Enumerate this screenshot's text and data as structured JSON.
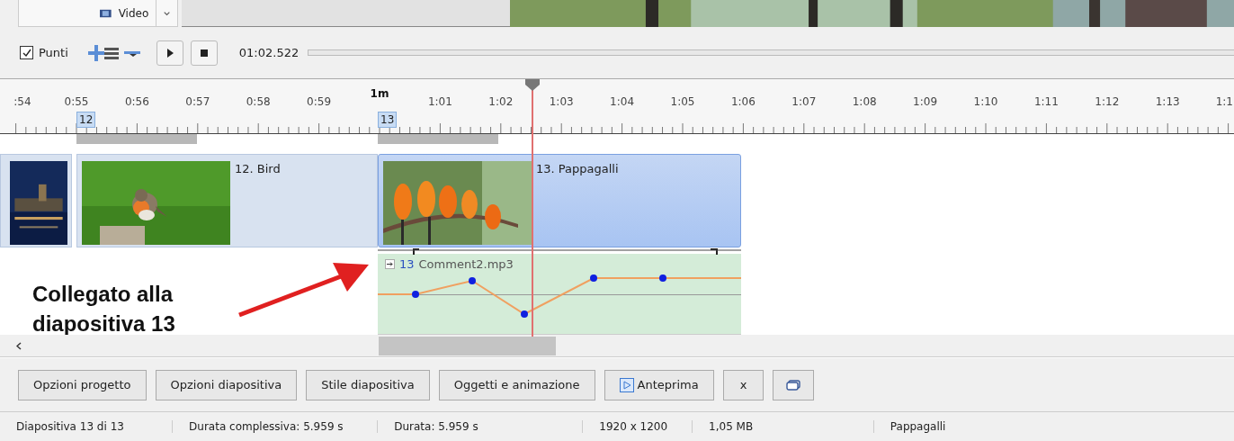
{
  "top": {
    "dropdown": "Video"
  },
  "toolbar": {
    "points": {
      "label": "Punti",
      "checked": true
    },
    "time": "01:02.522"
  },
  "ruler": {
    "labels": [
      {
        "text": ":54",
        "kind": "minor"
      },
      {
        "text": "0:55",
        "kind": "minor"
      },
      {
        "text": "0:56",
        "kind": "minor"
      },
      {
        "text": "0:57",
        "kind": "minor"
      },
      {
        "text": "0:58",
        "kind": "minor"
      },
      {
        "text": "0:59",
        "kind": "minor"
      },
      {
        "text": "1m",
        "kind": "major"
      },
      {
        "text": "1:01",
        "kind": "minor"
      },
      {
        "text": "1:02",
        "kind": "minor"
      },
      {
        "text": "1:03",
        "kind": "minor"
      },
      {
        "text": "1:04",
        "kind": "minor"
      },
      {
        "text": "1:05",
        "kind": "minor"
      },
      {
        "text": "1:06",
        "kind": "minor"
      },
      {
        "text": "1:07",
        "kind": "minor"
      },
      {
        "text": "1:08",
        "kind": "minor"
      },
      {
        "text": "1:09",
        "kind": "minor"
      },
      {
        "text": "1:10",
        "kind": "minor"
      },
      {
        "text": "1:11",
        "kind": "minor"
      },
      {
        "text": "1:12",
        "kind": "minor"
      },
      {
        "text": "1:13",
        "kind": "minor"
      },
      {
        "text": "1:1",
        "kind": "minor"
      }
    ]
  },
  "slides": [
    {
      "selected": false,
      "kind": "picture"
    },
    {
      "marker": "12",
      "title": "12. Bird",
      "selected": false,
      "kind": "picture"
    },
    {
      "marker": "13",
      "title": "13. Pappagalli",
      "selected": true,
      "kind": "picture"
    }
  ],
  "audio": {
    "slide": "13",
    "file": "Comment2.mp3"
  },
  "annotation": "Collegato alla diapositiva 13",
  "buttons": [
    {
      "label": "Opzioni progetto",
      "kind": "text"
    },
    {
      "label": "Opzioni diapositiva",
      "kind": "text"
    },
    {
      "label": "Stile diapositiva",
      "kind": "text"
    },
    {
      "label": "Oggetti e animazione",
      "kind": "text"
    },
    {
      "label": "Anteprima",
      "kind": "preview"
    },
    {
      "label": "x",
      "kind": "text"
    },
    {
      "kind": "icon"
    }
  ],
  "status_bar": [
    "Diapositiva 13 di 13",
    "Durata complessiva: 5.959 s",
    "Durata: 5.959 s",
    "1920 x 1200",
    "1,05 MB",
    "Pappagalli"
  ]
}
